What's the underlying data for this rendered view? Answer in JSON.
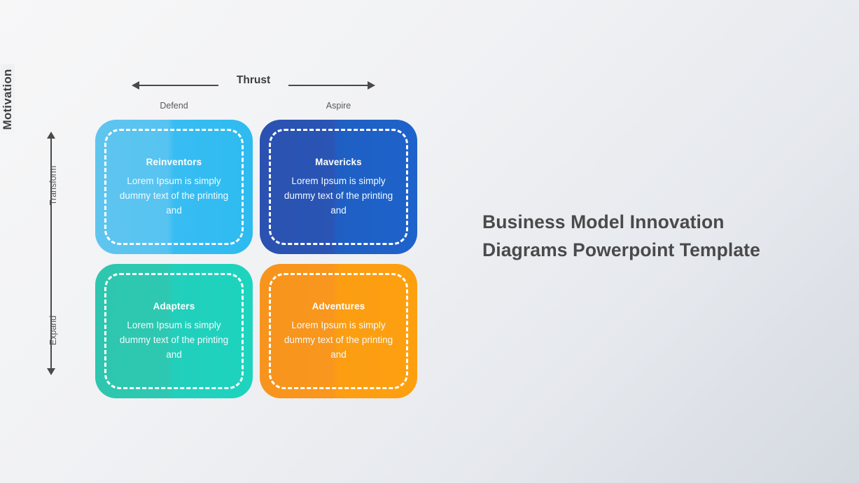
{
  "axes": {
    "horizontal": {
      "title": "Thrust",
      "left_label": "Defend",
      "right_label": "Aspire"
    },
    "vertical": {
      "title": "Motivation",
      "top_label": "Transform",
      "bottom_label": "Expand"
    }
  },
  "matrix": {
    "quadrants": [
      {
        "id": "reinventors",
        "title": "Reinventors",
        "body": "Lorem Ipsum is simply dummy text of the printing and",
        "color": "#38bdf2",
        "position": "top-left"
      },
      {
        "id": "mavericks",
        "title": "Mavericks",
        "body": "Lorem Ipsum is simply dummy text of the printing and",
        "color": "#2050b5",
        "position": "top-right"
      },
      {
        "id": "adapters",
        "title": "Adapters",
        "body": "Lorem Ipsum is simply dummy text of the printing and",
        "color": "#26cbb6",
        "position": "bottom-left"
      },
      {
        "id": "adventures",
        "title": "Adventures",
        "body": "Lorem Ipsum is simply dummy text of the printing and",
        "color": "#f9971a",
        "position": "bottom-right"
      }
    ]
  },
  "headline": {
    "text": "Business Model Innovation Diagrams Powerpoint Template",
    "color": "#4a4a4a"
  },
  "theme": {
    "background_start": "#f7f7f8",
    "background_end": "#d4d9e0",
    "axis_color": "#4a4a4a",
    "sub_label_color": "#58595b"
  }
}
